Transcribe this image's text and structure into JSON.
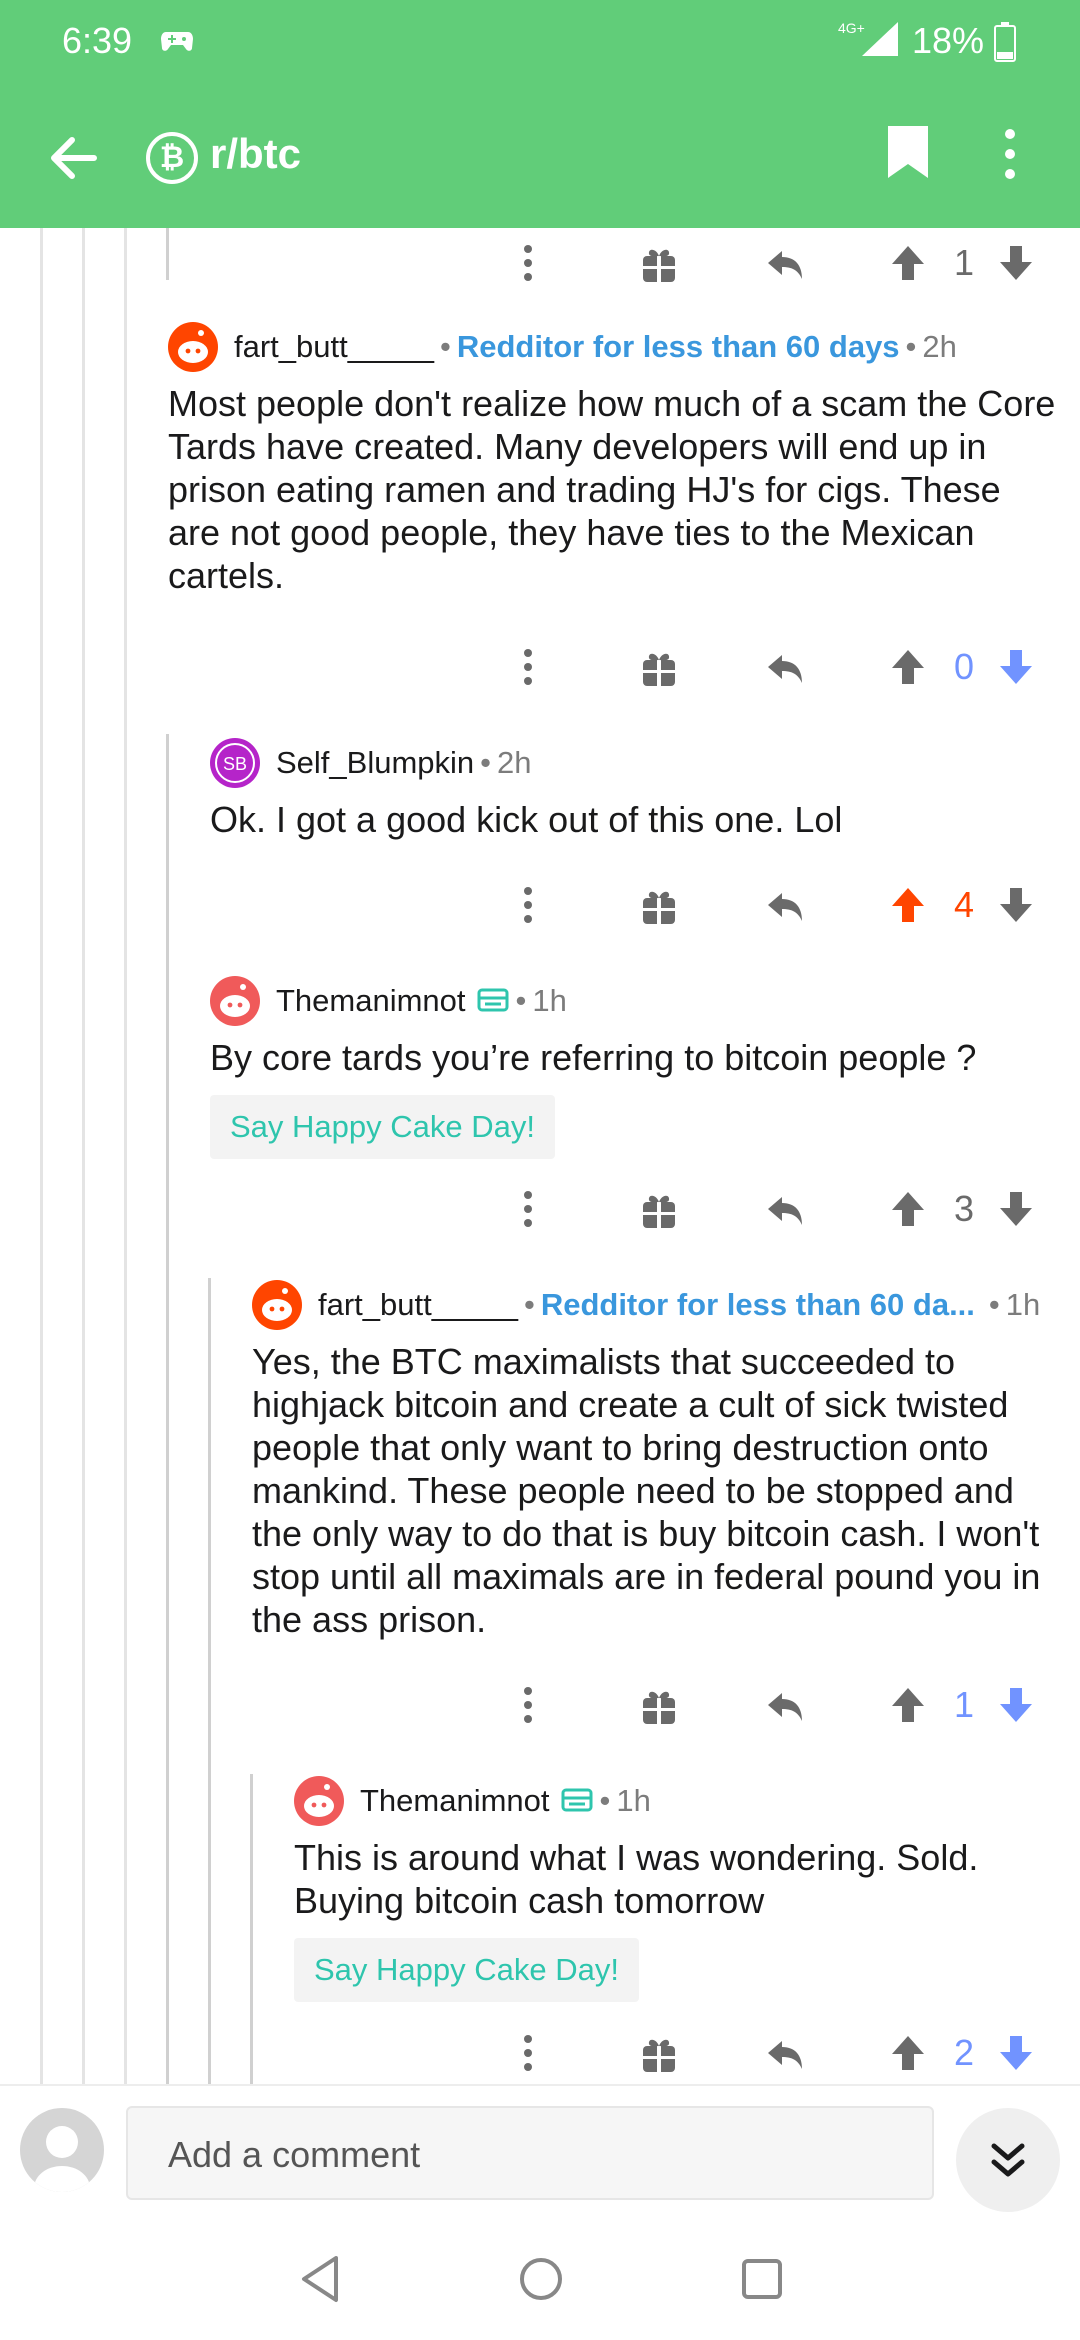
{
  "status_bar": {
    "time": "6:39",
    "network": "4G+",
    "battery": "18%"
  },
  "app_bar": {
    "subreddit": "r/btc",
    "sub_icon": "bitcoin-icon"
  },
  "comments": [
    {
      "votes": "1",
      "vote_state": "none"
    },
    {
      "user": "fart_butt_____",
      "flair": "Redditor for less than 60 days",
      "time": "2h",
      "body": "Most people don't realize how much of a scam the Core Tards have created.  Many developers will end up in prison eating ramen and trading HJ's for cigs.  These are not good people, they have ties to the Mexican cartels.",
      "votes": "0",
      "vote_state": "down"
    },
    {
      "user": "Self_Blumpkin",
      "time": "2h",
      "avatar_initials": "SB",
      "body": "Ok. I got a good kick out of this one. Lol",
      "votes": "4",
      "vote_state": "up"
    },
    {
      "user": "Themanimnot",
      "time": "1h",
      "body": "By core tards you’re referring to bitcoin people ?",
      "cake_day": "Say Happy Cake Day!",
      "votes": "3",
      "vote_state": "none"
    },
    {
      "user": "fart_butt_____",
      "flair": "Redditor for less than 60 da...",
      "time": "1h",
      "body": "Yes, the BTC maximalists that succeeded to highjack bitcoin and create a cult of sick twisted people that only want to bring destruction onto mankind.  These people need to be stopped and the only way to do that is buy bitcoin cash.  I won't stop until all maximals are in federal pound you in the ass prison.",
      "votes": "1",
      "vote_state": "down"
    },
    {
      "user": "Themanimnot",
      "time": "1h",
      "body": "This is around what I was wondering. Sold. Buying bitcoin cash tomorrow",
      "cake_day": "Say Happy Cake Day!",
      "votes": "2",
      "vote_state": "down"
    }
  ],
  "composer": {
    "placeholder": "Add a comment"
  },
  "colors": {
    "header": "#61cd79",
    "upvote": "#ff4500",
    "downvote": "#7193ff",
    "flair": "#3a97dd",
    "cake": "#2ec5ad"
  }
}
